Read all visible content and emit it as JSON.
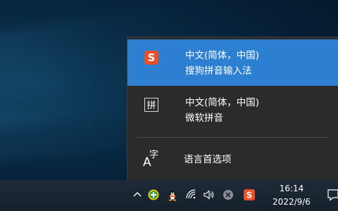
{
  "ime_menu": {
    "items": [
      {
        "language": "中文(简体，中国)",
        "name": "搜狗拼音输入法",
        "icon": "sogou-s-icon",
        "selected": true
      },
      {
        "language": "中文(简体，中国)",
        "name": "微软拼音",
        "icon": "pinyin-icon",
        "glyph": "拼",
        "selected": false
      }
    ],
    "language_preferences": {
      "label": "语言首选项",
      "icon": "language-settings-icon",
      "icon_big": "A",
      "icon_small": "字"
    },
    "colors": {
      "flyout_bg": "#2b2b2b",
      "selected_bg": "#2d7fd2",
      "sogou_red": "#e8502a"
    }
  },
  "taskbar": {
    "tray_icons": [
      "show-hidden-icons-chevron-icon",
      "green-plus-app-icon",
      "qq-penguin-icon",
      "wifi-icon",
      "volume-icon",
      "disconnected-x-icon",
      "sogou-ime-icon"
    ],
    "clock": {
      "time": "16:14",
      "date": "2022/9/6"
    },
    "notification_icon": "action-center-icon"
  }
}
